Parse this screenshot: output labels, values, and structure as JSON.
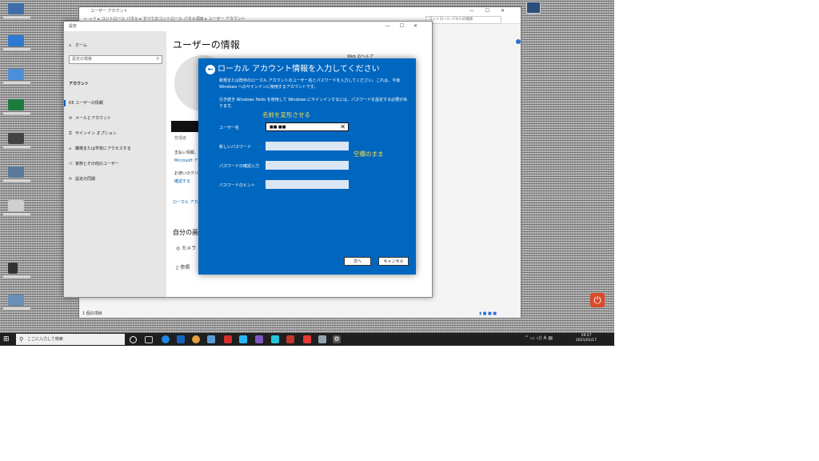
{
  "control_panel": {
    "title": "ユーザー アカウント",
    "address": "← → ↑ ▸ コントロール パネル ▸ すべてのコントロール パネル項目 ▸ ユーザー アカウント",
    "search_placeholder": "コントロール パネルの検索",
    "status_left": "1 個の項目",
    "status_right": "▮ ■ ■ ■"
  },
  "settings": {
    "title": "設定",
    "nav": {
      "home": "ホーム",
      "search_placeholder": "設定の検索",
      "section": "アカウント",
      "items": [
        {
          "icon": "RE",
          "label": "ユーザーの情報"
        },
        {
          "icon": "✉",
          "label": "メールとアカウント"
        },
        {
          "icon": "⚿",
          "label": "サインイン オプション"
        },
        {
          "icon": "⌂",
          "label": "職場または学校にアクセスする"
        },
        {
          "icon": "⚇",
          "label": "家族とその他のユーザー"
        },
        {
          "icon": "⟳",
          "label": "設定の同期"
        }
      ]
    },
    "page_title": "ユーザーの情報",
    "web_help": "Web のヘルプ",
    "admin_label": "管理者",
    "line1": "支払い情報、",
    "line1_link": "Microsoft アカ",
    "line2": "お使いのデバイ",
    "line2_link": "確認する",
    "local_link": "ローカル アカ",
    "create_image_heading": "自分の画像",
    "camera_label": "カメラ",
    "browse_label": "参照"
  },
  "dialog": {
    "title": "ローカル アカウント情報を入力してください",
    "description_1": "新規または既存のローカル アカウントのユーザー名とパスワードを入力してください。これは、今後 Windows へのサインインに使用するアカウントです。",
    "description_2": "引き続き Windows Hello を使用して Windows にサインインするには、パスワードを設定する必要があります。",
    "annotation_rename": "名前を変形させる",
    "annotation_blank": "空欄のまま",
    "fields": [
      {
        "label": "ユーザー名",
        "value": "■■ ■■"
      },
      {
        "label": "新しいパスワード",
        "value": ""
      },
      {
        "label": "パスワードの確認入力",
        "value": ""
      },
      {
        "label": "パスワードのヒント",
        "value": ""
      }
    ],
    "next_button": "次へ",
    "cancel_button": "キャンセル"
  },
  "taskbar": {
    "start_glyph": "⊞",
    "search_placeholder": "ここに入力して検索",
    "tray_icons": "^ ▭ ◁) A ▤",
    "time": "19:27",
    "date": "2021/01/17",
    "apps": [
      "edge-blue-icon",
      "edge-legacy-icon",
      "chrome-icon",
      "red-app-icon",
      "store-icon",
      "photo-icon",
      "ppt-icon",
      "gauge-icon",
      "red-pdf-icon",
      "mail-icon",
      "settings-icon"
    ]
  }
}
